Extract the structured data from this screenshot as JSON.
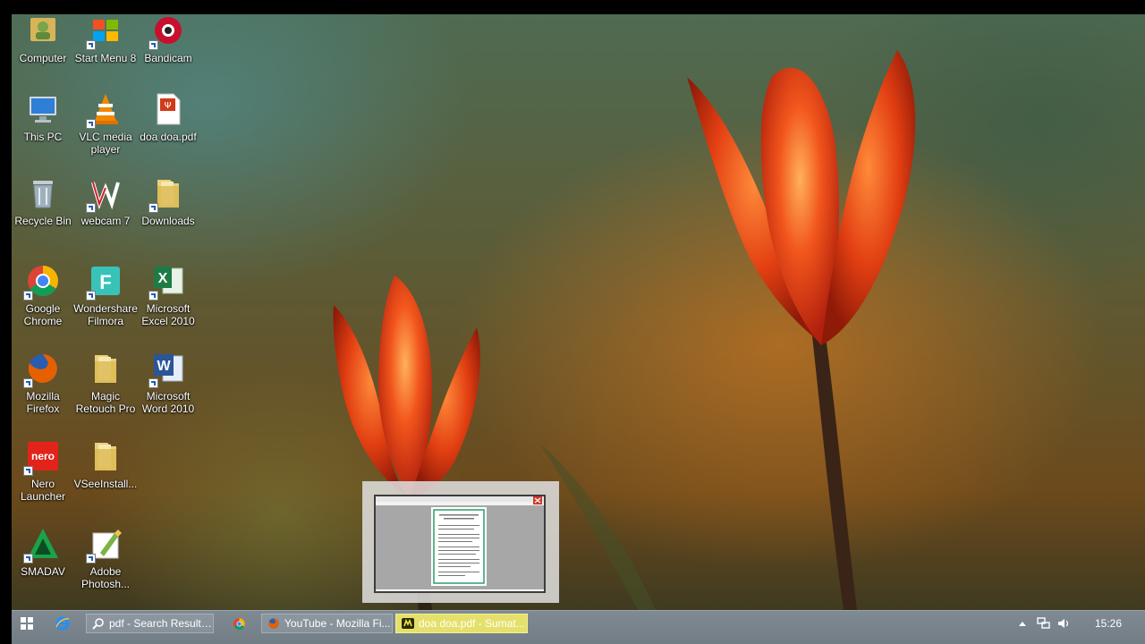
{
  "desktop": {
    "icons": [
      {
        "label": "Computer",
        "icon": "user-folder-icon"
      },
      {
        "label": "Start Menu 8",
        "icon": "start-menu-icon"
      },
      {
        "label": "Bandicam",
        "icon": "bandicam-icon"
      },
      {
        "label": "This PC",
        "icon": "monitor-icon"
      },
      {
        "label": "VLC media\nplayer",
        "icon": "vlc-cone-icon"
      },
      {
        "label": "doa doa.pdf",
        "icon": "pdf-file-icon"
      },
      {
        "label": "Recycle Bin",
        "icon": "recycle-bin-icon"
      },
      {
        "label": "webcam 7",
        "icon": "webcam-w-icon"
      },
      {
        "label": "Downloads",
        "icon": "folder-icon"
      },
      {
        "label": "Google\nChrome",
        "icon": "chrome-icon"
      },
      {
        "label": "Wondershare\nFilmora",
        "icon": "filmora-icon"
      },
      {
        "label": "Microsoft\nExcel 2010",
        "icon": "excel-icon"
      },
      {
        "label": "Mozilla\nFirefox",
        "icon": "firefox-icon"
      },
      {
        "label": "Magic\nRetouch Pro",
        "icon": "folder-icon"
      },
      {
        "label": "Microsoft\nWord 2010",
        "icon": "word-icon"
      },
      {
        "label": "Nero\nLauncher",
        "icon": "nero-icon"
      },
      {
        "label": "VSeeInstall...",
        "icon": "folder-icon"
      },
      {
        "label": "SMADAV",
        "icon": "smadav-icon"
      },
      {
        "label": "Adobe\nPhotosh...",
        "icon": "photoshop-icon"
      }
    ]
  },
  "taskbar": {
    "tasks": [
      {
        "label": "pdf - Search Results i...",
        "icon": "search-explorer-icon",
        "active": false
      },
      {
        "label": "YouTube - Mozilla Fi...",
        "icon": "firefox-icon",
        "active": false
      },
      {
        "label": "doa doa.pdf - Sumat...",
        "icon": "sumatra-pdf-icon",
        "active": true
      }
    ],
    "pinned": [
      "start-icon",
      "internet-explorer-icon",
      "chrome-icon"
    ],
    "tray_icons": [
      "tray-expand-icon",
      "network-icon",
      "volume-icon"
    ],
    "clock": "15:26"
  },
  "colors": {
    "taskbar": "#7a848d",
    "active_task": "#e5e06a",
    "tulip": "#f2551c"
  }
}
